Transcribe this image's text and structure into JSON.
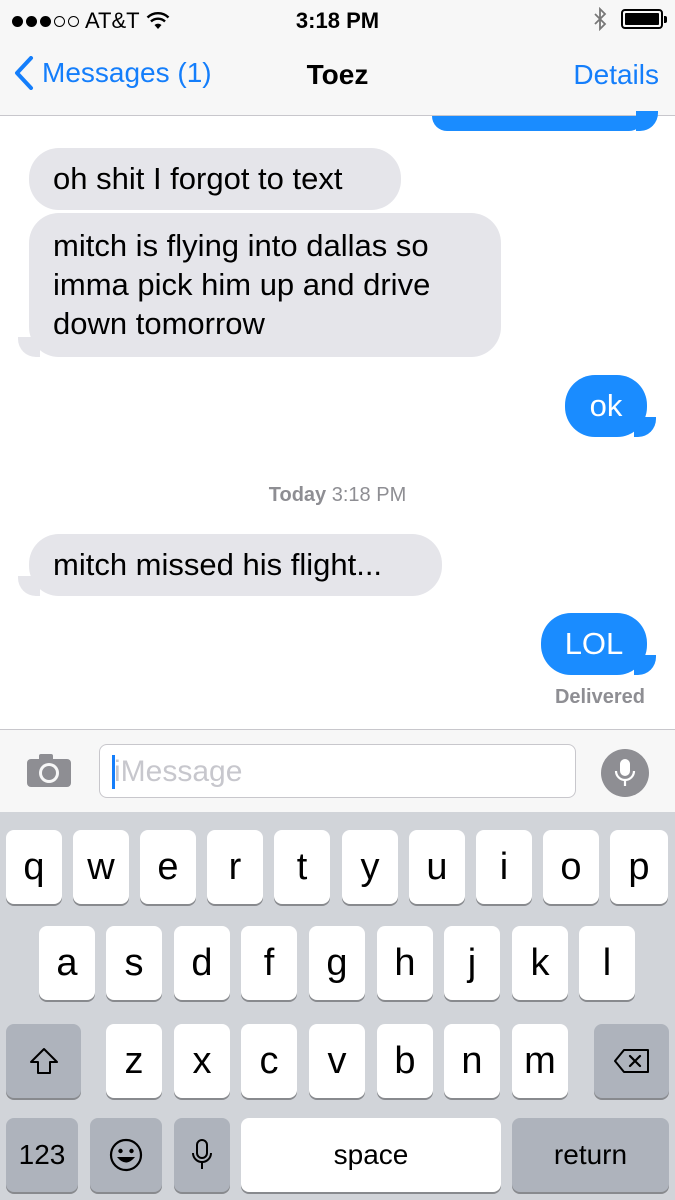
{
  "status_bar": {
    "carrier": "AT&T",
    "time": "3:18 PM"
  },
  "nav": {
    "back_label": "Messages (1)",
    "title": "Toez",
    "details_label": "Details"
  },
  "messages": [
    {
      "text": "oh shit I forgot to text",
      "direction": "incoming"
    },
    {
      "text": "mitch is flying into dallas so imma pick him up and drive down tomorrow",
      "direction": "incoming"
    },
    {
      "text": "ok",
      "direction": "outgoing"
    },
    {
      "text": "mitch missed his flight...",
      "direction": "incoming"
    },
    {
      "text": "LOL",
      "direction": "outgoing"
    }
  ],
  "timestamp": {
    "day": "Today",
    "time": "3:18 PM"
  },
  "delivered_label": "Delivered",
  "input": {
    "placeholder": "iMessage"
  },
  "keyboard": {
    "row1": [
      "q",
      "w",
      "e",
      "r",
      "t",
      "y",
      "u",
      "i",
      "o",
      "p"
    ],
    "row2": [
      "a",
      "s",
      "d",
      "f",
      "g",
      "h",
      "j",
      "k",
      "l"
    ],
    "row3": [
      "z",
      "x",
      "c",
      "v",
      "b",
      "n",
      "m"
    ],
    "numbers_label": "123",
    "space_label": "space",
    "return_label": "return"
  },
  "colors": {
    "accent": "#147efb",
    "outgoing_bubble": "#1a8cff",
    "incoming_bubble": "#e5e5ea",
    "keyboard_bg": "#d1d4d9"
  }
}
